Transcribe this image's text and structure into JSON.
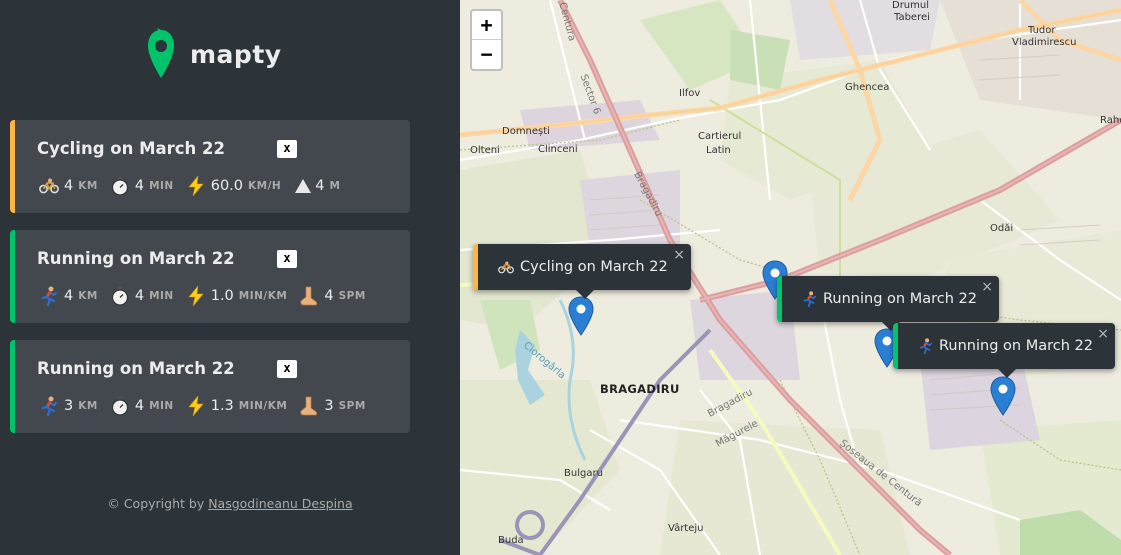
{
  "app": {
    "name": "mapty",
    "brand_color": "#00c46a"
  },
  "workouts": [
    {
      "type": "cycling",
      "title": "Cycling on March 22",
      "close_label": "x",
      "accent": "#ffb545",
      "details": [
        {
          "icon": "bicycle-icon",
          "value": "4",
          "unit": "KM"
        },
        {
          "icon": "stopwatch-icon",
          "value": "4",
          "unit": "MIN"
        },
        {
          "icon": "lightning-icon",
          "value": "60.0",
          "unit": "KM/H"
        },
        {
          "icon": "mountain-icon",
          "value": "4",
          "unit": "M"
        }
      ]
    },
    {
      "type": "running",
      "title": "Running on March 22",
      "close_label": "x",
      "accent": "#00c46a",
      "details": [
        {
          "icon": "runner-icon",
          "value": "4",
          "unit": "KM"
        },
        {
          "icon": "stopwatch-icon",
          "value": "4",
          "unit": "MIN"
        },
        {
          "icon": "lightning-icon",
          "value": "1.0",
          "unit": "MIN/KM"
        },
        {
          "icon": "foot-icon",
          "value": "4",
          "unit": "SPM"
        }
      ]
    },
    {
      "type": "running",
      "title": "Running on March 22",
      "close_label": "x",
      "accent": "#00c46a",
      "details": [
        {
          "icon": "runner-icon",
          "value": "3",
          "unit": "KM"
        },
        {
          "icon": "stopwatch-icon",
          "value": "4",
          "unit": "MIN"
        },
        {
          "icon": "lightning-icon",
          "value": "1.3",
          "unit": "MIN/KM"
        },
        {
          "icon": "foot-icon",
          "value": "3",
          "unit": "SPM"
        }
      ]
    }
  ],
  "copyright": {
    "prefix": "© Copyright by ",
    "author": "Nasgodineanu Despina"
  },
  "map": {
    "zoom_in": "+",
    "zoom_out": "−",
    "popups": [
      {
        "text": "Cycling on March 22",
        "close": "×"
      },
      {
        "text": "Running on March 22",
        "close": "×"
      },
      {
        "text": "Running on March 22",
        "close": "×"
      }
    ],
    "labels": {
      "drumul_taberei": "Drumul Taberei",
      "drumul": "Drumul",
      "taberei": "Taberei",
      "tudor": "Tudor",
      "vladimirescu": "Vladimirescu",
      "ghencea": "Ghencea",
      "rahova": "Rahc",
      "sector6": "Sector 6",
      "centura": "Centura",
      "ilfov": "Ilfov",
      "cartierul": "Cartierul",
      "latin": "Latin",
      "domnesti": "Domnești",
      "olteni": "Olteni",
      "clinceni": "Clinceni",
      "bragadiru_road": "Bragadiru",
      "odai": "Odăi",
      "ciorogarla": "Ciorogârla",
      "bragadiru": "BRAGADIRU",
      "bragadiru_magurele_1": "Bragadiru",
      "bragadiru_magurele_2": "Măgurele",
      "soseaua": "Șoseaua de Centură",
      "bulgaru": "Bulgaru",
      "varteju": "Vârteju",
      "buda": "Buda"
    }
  }
}
